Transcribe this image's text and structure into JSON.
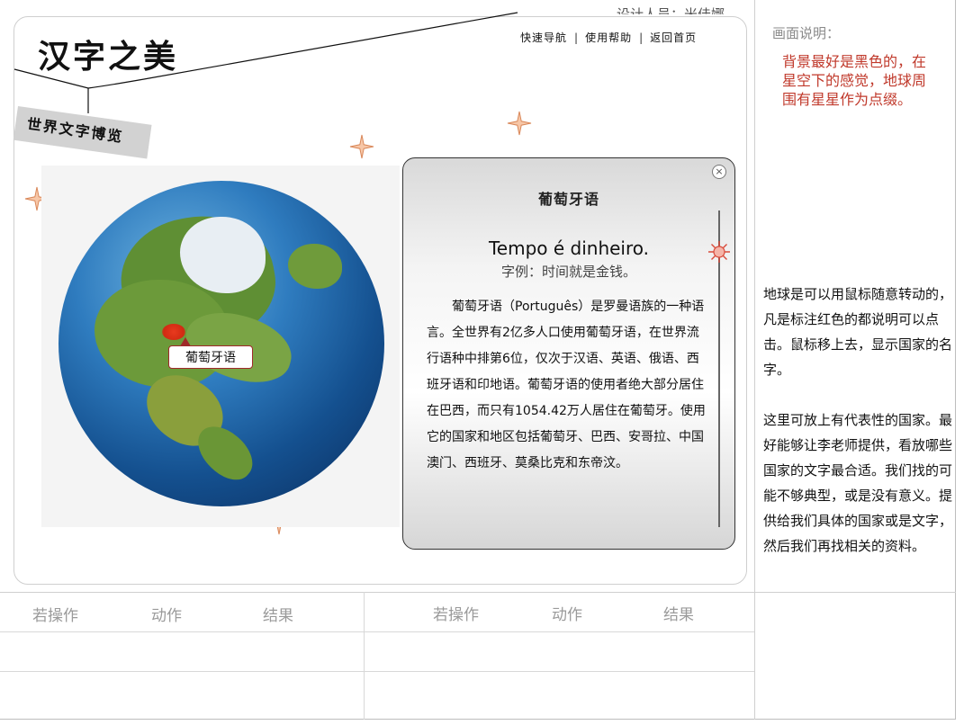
{
  "header": {
    "logo_text": "汉字之美",
    "subtitle_text": "世界文字博览",
    "designer_label": "设计人员：米佳娜"
  },
  "nav": {
    "items": [
      "快速导航",
      "使用帮助",
      "返回首页"
    ]
  },
  "globe": {
    "hotspot_label": "葡萄牙语"
  },
  "popup": {
    "title": "葡萄牙语",
    "phrase": "Tempo é dinheiro.",
    "example": "字例：时间就是金钱。",
    "body": "葡萄牙语（Português）是罗曼语族的一种语言。全世界有2亿多人口使用葡萄牙语，在世界流行语种中排第6位，仅次于汉语、英语、俄语、西班牙语和印地语。葡萄牙语的使用者绝大部分居住在巴西，而只有1054.42万人居住在葡萄牙。使用它的国家和地区包括葡萄牙、巴西、安哥拉、中国澳门、西班牙、莫桑比克和东帝汶。",
    "close_symbol": "×"
  },
  "notes": {
    "title": "画面说明：",
    "red_note": "背景最好是黑色的，在星空下的感觉，地球周围有星星作为点缀。",
    "black_note_1": "地球是可以用鼠标随意转动的，凡是标注红色的都说明可以点击。鼠标移上去，显示国家的名字。",
    "black_note_2": "这里可放上有代表性的国家。最好能够让李老师提供，看放哪些国家的文字最合适。我们找的可能不够典型，或是没有意义。提供给我们具体的国家或是文字，然后我们再找相关的资料。"
  },
  "table": {
    "left": {
      "col1": "若操作",
      "col2": "动作",
      "col3": "结果"
    },
    "right": {
      "col1": "若操作",
      "col2": "动作",
      "col3": "结果"
    }
  },
  "colors": {
    "accent_red": "#c0392b",
    "hotspot_red": "#e83a1e",
    "star_color": "#e8a27a"
  }
}
